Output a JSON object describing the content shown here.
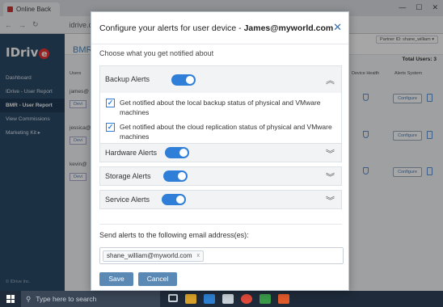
{
  "browser": {
    "tab_title": "Online Back",
    "url": "idrive.com/",
    "window_controls": [
      "—",
      "☐",
      "✕"
    ]
  },
  "app": {
    "logo_text": "IDriv",
    "logo_e": "e",
    "nav": [
      "Dashboard",
      "IDrive - User Report",
      "BMR - User Report",
      "View Commissions",
      "Marketing Kit  ▸"
    ],
    "copyright": "© IDrive Inc.",
    "page_title": "BMR - ",
    "partner_label": "Partner ID: shane_william ▾",
    "total_users": "Total Users: 3",
    "col_users": "Users ",
    "col_device_health": "Device Health",
    "col_alerts_system": "Alerts System",
    "rows": [
      {
        "user": "james@",
        "btn": "Devi",
        "configure": "Configure"
      },
      {
        "user": "jessica@",
        "btn": "Devi",
        "configure": "Configure"
      },
      {
        "user": "kevin@",
        "btn": "Devi",
        "configure": "Configure"
      }
    ]
  },
  "modal": {
    "title_prefix": "Configure your alerts for user device - ",
    "title_email": "James@myworld.com",
    "close": "✕",
    "subtitle": "Choose what you get notified about",
    "groups": [
      {
        "label": "Backup Alerts",
        "enabled": true,
        "expanded": true,
        "chevron": "︽"
      },
      {
        "label": "Hardware Alerts",
        "enabled": true,
        "expanded": false,
        "chevron": "︾"
      },
      {
        "label": "Storage Alerts",
        "enabled": true,
        "expanded": false,
        "chevron": "︾"
      },
      {
        "label": "Service Alerts",
        "enabled": true,
        "expanded": false,
        "chevron": "︾"
      }
    ],
    "backup_options": [
      {
        "checked": true,
        "mark": "✓",
        "text": "Get notified about the local backup status of physical and VMware machines"
      },
      {
        "checked": true,
        "mark": "✓",
        "text": "Get notified about the cloud replication status of physical and VMware machines"
      }
    ],
    "email_label": "Send alerts to the following email address(es):",
    "email_chips": [
      {
        "value": "shane_william@myworld.com",
        "remove": "x"
      }
    ],
    "save_label": "Save",
    "cancel_label": "Cancel"
  },
  "taskbar": {
    "search_placeholder": "Type here to search"
  },
  "colors": {
    "accent": "#2f7ed8",
    "button": "#5a89b6",
    "sidebar": "#2b4a68"
  }
}
